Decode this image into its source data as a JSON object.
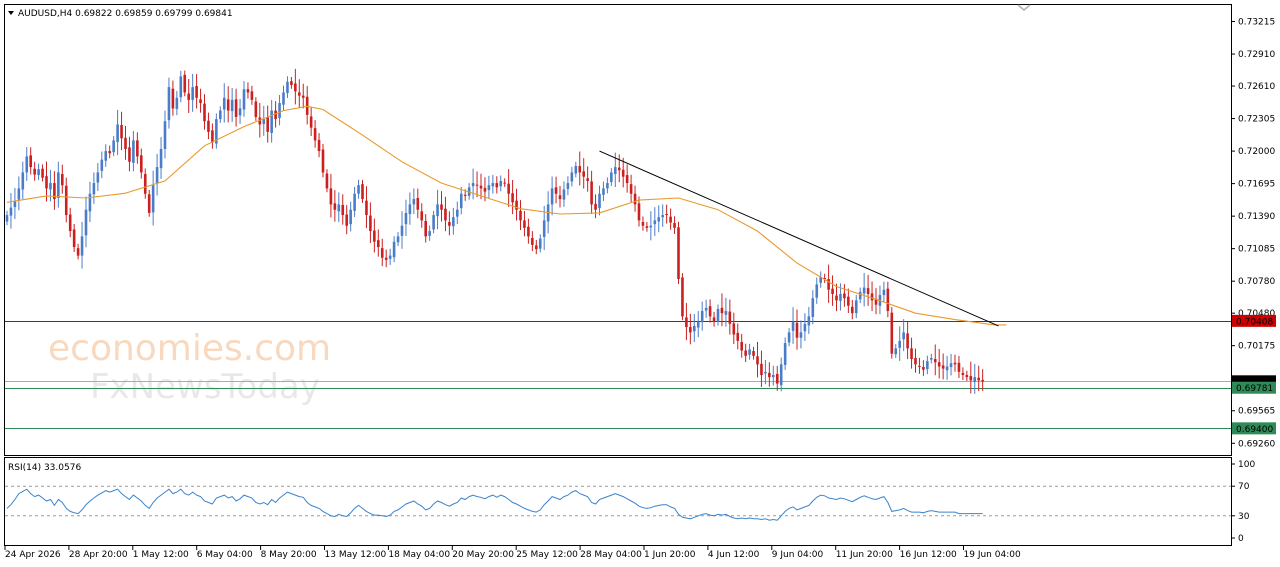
{
  "chart_title": "AUDUSD,H4  0.69822 0.69859 0.69799 0.69841",
  "rsi_title": "RSI(14) 33.0576",
  "watermark": {
    "line1": "economies.com",
    "line2": "FxNewsToday"
  },
  "price_axis": {
    "ticks": [
      "0.73215",
      "0.72910",
      "0.72610",
      "0.72305",
      "0.72000",
      "0.71695",
      "0.71390",
      "0.71085",
      "0.70780",
      "0.70480",
      "0.70175",
      "0.69565",
      "0.69260"
    ]
  },
  "price_labels": [
    {
      "text": "0.70408",
      "value": 0.70408,
      "color": "#cc0000"
    },
    {
      "text": "0.69841",
      "value": 0.69841,
      "color": "#000000"
    },
    {
      "text": "0.69781",
      "value": 0.69781,
      "color": "#2e8b57"
    },
    {
      "text": "0.69400",
      "value": 0.694,
      "color": "#2e8b57"
    }
  ],
  "rsi_axis": {
    "ticks": [
      "100",
      "70",
      "30",
      "0"
    ]
  },
  "time_axis": {
    "labels": [
      "24 Apr 2026",
      "28 Apr 20:00",
      "1 May 12:00",
      "6 May 04:00",
      "8 May 20:00",
      "13 May 12:00",
      "18 May 04:00",
      "20 May 20:00",
      "25 May 12:00",
      "28 May 04:00",
      "1 Jun 20:00",
      "4 Jun 12:00",
      "9 Jun 04:00",
      "11 Jun 20:00",
      "16 Jun 12:00",
      "19 Jun 04:00"
    ]
  },
  "chart_data": {
    "type": "candlestick",
    "symbol": "AUDUSD",
    "timeframe": "H4",
    "ohlc_last": {
      "open": 0.69822,
      "high": 0.69859,
      "low": 0.69799,
      "close": 0.69841
    },
    "ylim": [
      0.6915,
      0.7337
    ],
    "horizontal_lines": [
      {
        "value": 0.70408,
        "color": "#cc0000"
      },
      {
        "value": 0.69841,
        "color": "#aaaaaa"
      },
      {
        "value": 0.69781,
        "color": "#2e8b57"
      },
      {
        "value": 0.694,
        "color": "#2e8b57"
      }
    ],
    "trendline": {
      "start": [
        150,
        0.72
      ],
      "end": [
        251,
        0.7036
      ]
    },
    "colors": {
      "bull": "#4a7cc9",
      "bear": "#cc1f1f",
      "ma": "#e89a2a",
      "rsi": "#3a84cc"
    },
    "close_series": [
      0.714,
      0.7147,
      0.7153,
      0.7165,
      0.718,
      0.7195,
      0.7185,
      0.7178,
      0.7183,
      0.7175,
      0.7165,
      0.717,
      0.7155,
      0.718,
      0.7168,
      0.714,
      0.7125,
      0.711,
      0.7102,
      0.712,
      0.7145,
      0.716,
      0.717,
      0.718,
      0.7192,
      0.72,
      0.7198,
      0.721,
      0.7225,
      0.7212,
      0.7202,
      0.719,
      0.721,
      0.7195,
      0.718,
      0.716,
      0.7142,
      0.7168,
      0.7185,
      0.7202,
      0.7228,
      0.726,
      0.724,
      0.725,
      0.727,
      0.7255,
      0.7248,
      0.726,
      0.725,
      0.7245,
      0.7228,
      0.7218,
      0.7208,
      0.723,
      0.7238,
      0.725,
      0.7238,
      0.7248,
      0.7232,
      0.724,
      0.7258,
      0.7255,
      0.7248,
      0.7232,
      0.7225,
      0.723,
      0.7218,
      0.7238,
      0.723,
      0.7245,
      0.7255,
      0.7265,
      0.7262,
      0.7256,
      0.7252,
      0.725,
      0.7234,
      0.7222,
      0.721,
      0.72,
      0.718,
      0.7165,
      0.715,
      0.7145,
      0.715,
      0.714,
      0.713,
      0.7145,
      0.716,
      0.7168,
      0.7155,
      0.714,
      0.7125,
      0.7115,
      0.711,
      0.71,
      0.7098,
      0.7102,
      0.7115,
      0.712,
      0.713,
      0.7142,
      0.715,
      0.7155,
      0.7145,
      0.7135,
      0.712,
      0.7125,
      0.714,
      0.715,
      0.7145,
      0.7135,
      0.713,
      0.7138,
      0.7145,
      0.716,
      0.7158,
      0.7166,
      0.717,
      0.7168,
      0.7165,
      0.7162,
      0.7168,
      0.717,
      0.7166,
      0.7172,
      0.717,
      0.716,
      0.7152,
      0.7145,
      0.7135,
      0.7128,
      0.712,
      0.7112,
      0.7108,
      0.7118,
      0.7135,
      0.715,
      0.7165,
      0.716,
      0.7155,
      0.7164,
      0.717,
      0.718,
      0.7186,
      0.718,
      0.7176,
      0.7172,
      0.715,
      0.7145,
      0.716,
      0.7165,
      0.717,
      0.718,
      0.7185,
      0.7182,
      0.7176,
      0.717,
      0.716,
      0.715,
      0.7135,
      0.713,
      0.7128,
      0.713,
      0.7135,
      0.7138,
      0.714,
      0.714,
      0.7133,
      0.7128,
      0.708,
      0.7045,
      0.7035,
      0.703,
      0.7036,
      0.704,
      0.705,
      0.7053,
      0.7045,
      0.704,
      0.7052,
      0.7048,
      0.705,
      0.7038,
      0.7028,
      0.7022,
      0.7013,
      0.7008,
      0.7014,
      0.7008,
      0.7,
      0.699,
      0.6993,
      0.6988,
      0.699,
      0.6982,
      0.7,
      0.702,
      0.703,
      0.704,
      0.7025,
      0.703,
      0.7038,
      0.7045,
      0.7062,
      0.7075,
      0.7082,
      0.708,
      0.707,
      0.7066,
      0.706,
      0.7066,
      0.7062,
      0.7055,
      0.7048,
      0.706,
      0.7068,
      0.7072,
      0.7066,
      0.706,
      0.7056,
      0.7065,
      0.707,
      0.705,
      0.701,
      0.7015,
      0.7022,
      0.703,
      0.7015,
      0.7005,
      0.7,
      0.6998,
      0.6995,
      0.7003,
      0.7006,
      0.7002,
      0.6998,
      0.6996,
      0.6998,
      0.7001,
      0.7,
      0.6993,
      0.699,
      0.6988,
      0.6985,
      0.6988,
      0.6985,
      0.6984
    ],
    "ma_series": [
      [
        0,
        0.7152
      ],
      [
        10,
        0.7158
      ],
      [
        20,
        0.7156
      ],
      [
        30,
        0.71605
      ],
      [
        40,
        0.7172
      ],
      [
        50,
        0.7205
      ],
      [
        60,
        0.7223
      ],
      [
        70,
        0.7238
      ],
      [
        76,
        0.7242
      ],
      [
        80,
        0.7239
      ],
      [
        90,
        0.7215
      ],
      [
        100,
        0.719
      ],
      [
        110,
        0.717
      ],
      [
        120,
        0.7158
      ],
      [
        130,
        0.7146
      ],
      [
        140,
        0.7141
      ],
      [
        150,
        0.7142
      ],
      [
        160,
        0.7154
      ],
      [
        170,
        0.7156
      ],
      [
        180,
        0.7145
      ],
      [
        190,
        0.7125
      ],
      [
        200,
        0.7095
      ],
      [
        210,
        0.7073
      ],
      [
        220,
        0.7061
      ],
      [
        230,
        0.7048
      ],
      [
        240,
        0.7042
      ],
      [
        250,
        0.7037
      ],
      [
        253,
        0.7037
      ]
    ],
    "rsi": {
      "period": 14,
      "value": 33.0576,
      "ylim": [
        0,
        100
      ],
      "levels": [
        70,
        30
      ],
      "series": [
        40,
        45,
        52,
        60,
        63,
        66,
        60,
        56,
        58,
        54,
        50,
        52,
        44,
        52,
        48,
        40,
        36,
        34,
        33,
        38,
        45,
        50,
        54,
        58,
        61,
        64,
        62,
        64,
        66,
        60,
        56,
        52,
        58,
        54,
        50,
        44,
        40,
        48,
        54,
        58,
        62,
        66,
        60,
        62,
        66,
        60,
        58,
        62,
        58,
        56,
        50,
        48,
        46,
        54,
        56,
        58,
        54,
        56,
        50,
        53,
        58,
        56,
        54,
        48,
        46,
        48,
        45,
        52,
        48,
        54,
        58,
        62,
        60,
        58,
        56,
        55,
        48,
        44,
        42,
        40,
        36,
        33,
        30,
        29,
        32,
        30,
        29,
        34,
        40,
        44,
        40,
        36,
        33,
        31,
        31,
        30,
        29,
        31,
        36,
        38,
        42,
        46,
        48,
        50,
        46,
        43,
        38,
        40,
        46,
        50,
        48,
        45,
        43,
        46,
        48,
        54,
        52,
        56,
        58,
        56,
        55,
        53,
        56,
        58,
        55,
        58,
        56,
        52,
        48,
        46,
        43,
        40,
        38,
        36,
        35,
        38,
        45,
        50,
        56,
        54,
        52,
        56,
        58,
        62,
        64,
        60,
        58,
        56,
        48,
        46,
        52,
        54,
        56,
        58,
        60,
        58,
        56,
        53,
        50,
        47,
        43,
        41,
        40,
        41,
        43,
        44,
        45,
        45,
        42,
        40,
        32,
        28,
        27,
        26,
        28,
        30,
        32,
        33,
        31,
        30,
        32,
        31,
        32,
        29,
        27,
        26,
        27,
        26,
        27,
        26,
        26,
        25,
        26,
        24,
        25,
        24,
        30,
        36,
        40,
        42,
        38,
        40,
        42,
        44,
        50,
        55,
        58,
        57,
        54,
        53,
        52,
        54,
        53,
        51,
        49,
        52,
        55,
        57,
        55,
        53,
        52,
        54,
        56,
        48,
        36,
        37,
        38,
        40,
        37,
        35,
        35,
        35,
        34,
        36,
        37,
        36,
        35,
        35,
        35,
        35,
        35,
        33,
        33,
        33,
        33,
        33,
        33,
        33
      ]
    }
  }
}
